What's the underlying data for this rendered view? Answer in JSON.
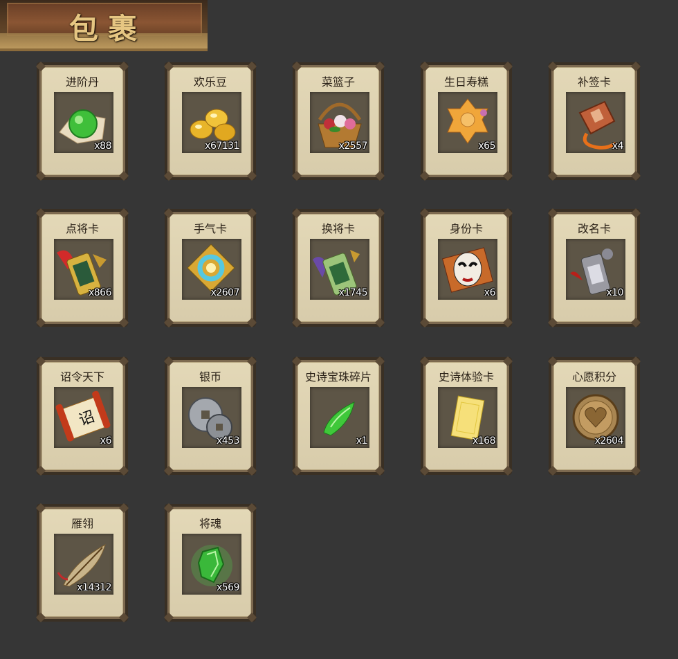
{
  "header": {
    "title": "包裹"
  },
  "items": [
    {
      "name": "进阶丹",
      "count": "x88",
      "icon": "green-pill-icon"
    },
    {
      "name": "欢乐豆",
      "count": "x67131",
      "icon": "gold-beans-icon"
    },
    {
      "name": "菜篮子",
      "count": "x2557",
      "icon": "flower-basket-icon"
    },
    {
      "name": "生日寿糕",
      "count": "x65",
      "icon": "birthday-cake-icon"
    },
    {
      "name": "补签卡",
      "count": "x4",
      "icon": "sign-card-icon"
    },
    {
      "name": "点将卡",
      "count": "x866",
      "icon": "general-token-icon"
    },
    {
      "name": "手气卡",
      "count": "x2607",
      "icon": "luck-card-icon"
    },
    {
      "name": "换将卡",
      "count": "x1745",
      "icon": "swap-token-icon"
    },
    {
      "name": "身份卡",
      "count": "x6",
      "icon": "mask-card-icon"
    },
    {
      "name": "改名卡",
      "count": "x10",
      "icon": "rename-token-icon"
    },
    {
      "name": "诏令天下",
      "count": "x6",
      "icon": "scroll-icon"
    },
    {
      "name": "银币",
      "count": "x453",
      "icon": "silver-coin-icon"
    },
    {
      "name": "史诗宝珠碎片",
      "count": "x1",
      "icon": "green-shard-icon"
    },
    {
      "name": "史诗体验卡",
      "count": "x168",
      "icon": "gold-card-icon"
    },
    {
      "name": "心愿积分",
      "count": "x2604",
      "icon": "heart-coin-icon"
    },
    {
      "name": "雁翎",
      "count": "x14312",
      "icon": "feather-icon"
    },
    {
      "name": "将魂",
      "count": "x569",
      "icon": "green-crystal-icon"
    }
  ]
}
